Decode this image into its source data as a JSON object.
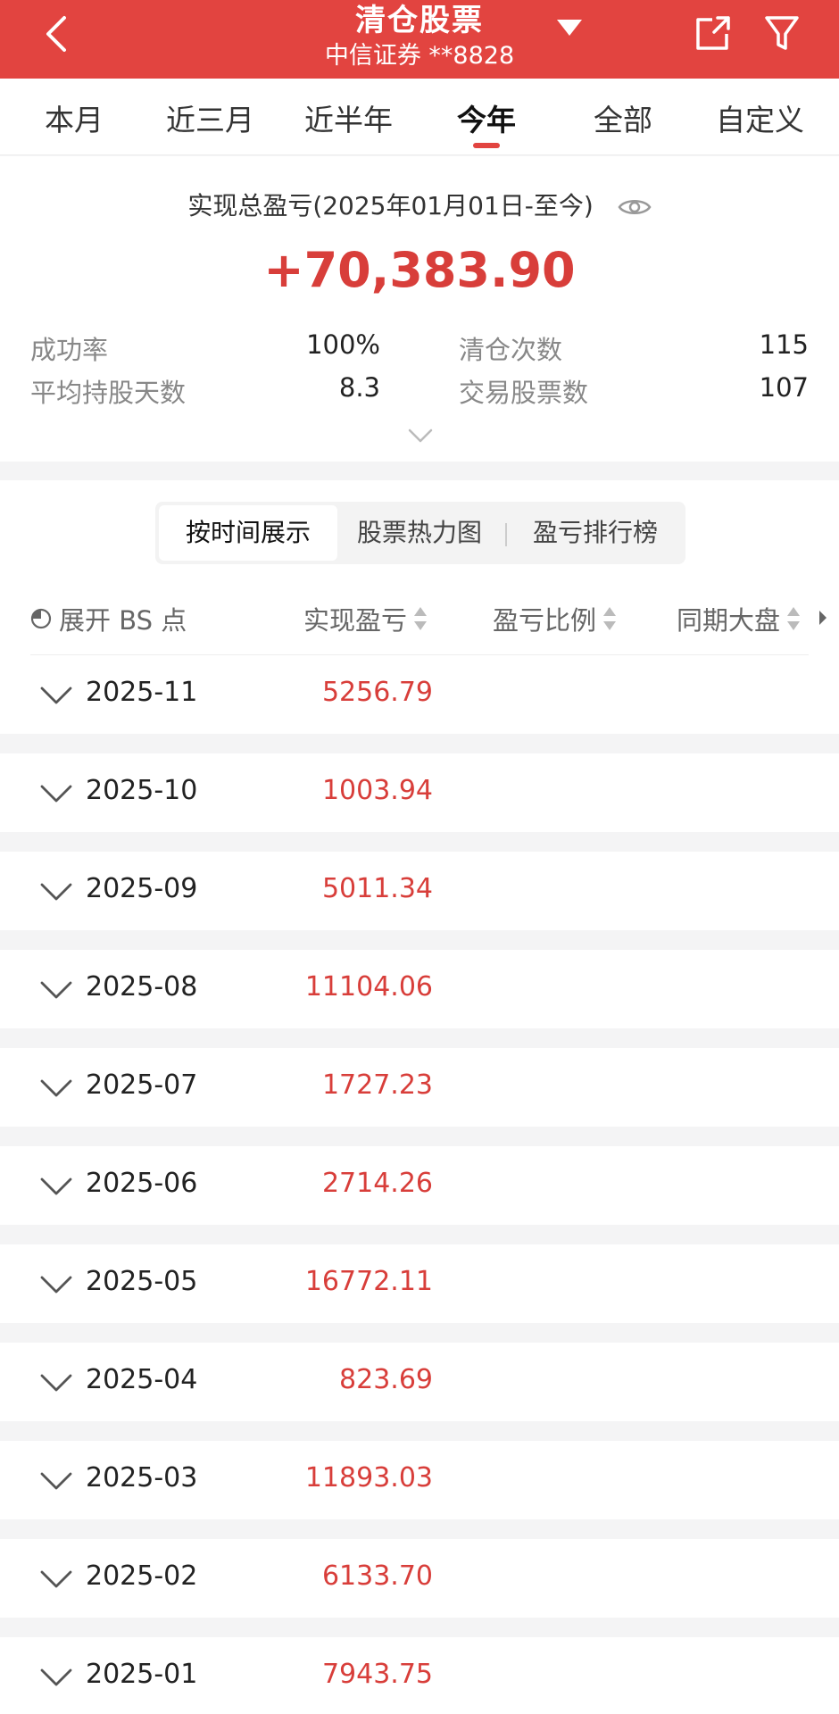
{
  "header": {
    "title": "清仓股票",
    "subtitle": "中信证券 **8828"
  },
  "tabs": [
    {
      "label": "本月"
    },
    {
      "label": "近三月"
    },
    {
      "label": "近半年"
    },
    {
      "label": "今年"
    },
    {
      "label": "全部"
    },
    {
      "label": "自定义"
    }
  ],
  "summary": {
    "label": "实现总盈亏(2025年01月01日-至今)",
    "total": "+70,383.90",
    "stats": {
      "success_rate_label": "成功率",
      "success_rate": "100%",
      "clear_count_label": "清仓次数",
      "clear_count": "115",
      "avg_days_label": "平均持股天数",
      "avg_days": "8.3",
      "stock_count_label": "交易股票数",
      "stock_count": "107"
    }
  },
  "segment": {
    "by_time": "按时间展示",
    "heatmap": "股票热力图",
    "ranking": "盈亏排行榜"
  },
  "columns": {
    "expand_bs": "展开 BS 点",
    "realized_pnl": "实现盈亏",
    "pnl_ratio": "盈亏比例",
    "market": "同期大盘"
  },
  "rows": [
    {
      "month": "2025-11",
      "pnl": "5256.79"
    },
    {
      "month": "2025-10",
      "pnl": "1003.94"
    },
    {
      "month": "2025-09",
      "pnl": "5011.34"
    },
    {
      "month": "2025-08",
      "pnl": "11104.06"
    },
    {
      "month": "2025-07",
      "pnl": "1727.23"
    },
    {
      "month": "2025-06",
      "pnl": "2714.26"
    },
    {
      "month": "2025-05",
      "pnl": "16772.11"
    },
    {
      "month": "2025-04",
      "pnl": "823.69"
    },
    {
      "month": "2025-03",
      "pnl": "11893.03"
    },
    {
      "month": "2025-02",
      "pnl": "6133.70"
    },
    {
      "month": "2025-01",
      "pnl": "7943.75"
    }
  ],
  "colors": {
    "brand_red": "#e24440",
    "profit_red": "#d83e3a"
  }
}
